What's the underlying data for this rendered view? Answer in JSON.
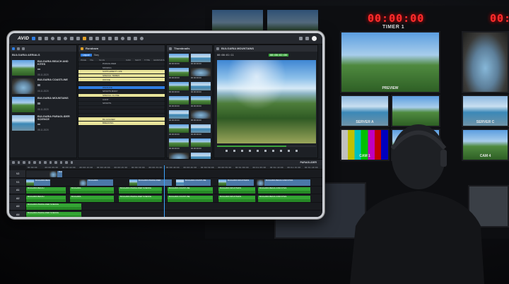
{
  "background": {
    "timers": [
      {
        "value": "00:00:00",
        "label": "TIMER 1"
      },
      {
        "value": "00:0",
        "label": ""
      }
    ],
    "monitors": [
      {
        "label": "PREVIEW"
      },
      {
        "label": "SERVER A"
      },
      {
        "label": "SERVER C"
      },
      {
        "label": "CAM 1"
      },
      {
        "label": "CAM 4"
      }
    ]
  },
  "app": {
    "logo": "AVID",
    "colors": {
      "accent": "#2f7de1",
      "audio_clip": "#34a534",
      "video_clip": "#4b78a8",
      "highlight_row": "#e8e39a",
      "timecode_green": "#3ba23c"
    }
  },
  "media_panel": {
    "title": "BULGARIA AERIALS",
    "items": [
      {
        "name": "BULGARIA BEACH AND KITES",
        "date": "05.11.2020"
      },
      {
        "name": "BULGARIA COASTLINE",
        "date": "05.11.2020"
      },
      {
        "name": "BULGARIA MOUNTAINS",
        "date": "05.11.2020"
      },
      {
        "name": "BULGARIA PARAGLIDER SCIENCE",
        "date": "05.11.2020"
      }
    ]
  },
  "bin_panel": {
    "title": "Rundown",
    "tabs": [
      "Layout",
      "Story"
    ],
    "columns": [
      "PAGE",
      "TAL",
      "SLUG",
      "CAM",
      "SHOT",
      "TYPE",
      "GRAPHICS"
    ],
    "rows": [
      {
        "slug": "PARAGLIDER",
        "style": "d"
      },
      {
        "slug": "MISSING",
        "style": "d"
      },
      {
        "slug": "SUPPLEMENT LIVE",
        "style": "y"
      },
      {
        "slug": "SPECIAL TRIBES",
        "style": "y"
      },
      {
        "slug": "OFFICE",
        "style": "y"
      },
      {
        "slug": "",
        "style": "d"
      },
      {
        "slug": "WILDLIFE",
        "style": "b"
      },
      {
        "slug": "SPORTS BODY",
        "style": "d"
      },
      {
        "slug": "SPECIAL CLOSE",
        "style": "y"
      },
      {
        "slug": "CONT",
        "style": "d"
      },
      {
        "slug": "SPORTS",
        "style": "d"
      },
      {
        "slug": "",
        "style": "d"
      },
      {
        "slug": "",
        "style": "d"
      },
      {
        "slug": "",
        "style": "d"
      },
      {
        "slug": "BG HOLDER",
        "style": "y"
      },
      {
        "slug": "BREAKING",
        "style": "y"
      }
    ]
  },
  "thumb_panel": {
    "title": "Thumbnails",
    "items": [
      "00:00:00:00",
      "00:00:00:00",
      "00:00:00:00",
      "00:00:00:00",
      "00:00:00:00",
      "00:00:00:00",
      "00:00:00:00",
      "00:00:00:00",
      "00:00:00:00",
      "00:00:00:00",
      "00:00:00:00",
      "00:00:00:00",
      "00:00:00:00",
      "00:00:00:00",
      "00:00:00:00",
      "00:00:00:00"
    ]
  },
  "viewer": {
    "title": "BULGARIA MOUNTAINS",
    "timecode_left": "00:00:01:11",
    "timecode_right": "00:00:02:00"
  },
  "timeline": {
    "sequence_name": "PARAGLIDER",
    "ruler": [
      "00:00:00",
      "00:00:05:00",
      "00:00:10:00",
      "00:00:15:00",
      "00:00:20:00",
      "00:00:25:00",
      "00:00:30:00",
      "00:00:35:00",
      "00:00:40:00",
      "00:00:45:00",
      "00:00:50:00",
      "00:00:55:00",
      "00:01:00:00",
      "00:01:05:00",
      "00:01:10:00",
      "00:01:15:00",
      "00:01:20:00"
    ],
    "tracks": [
      {
        "name": "V2",
        "clips": [
          {
            "kind": "dk",
            "name": ""
          },
          {
            "kind": "v",
            "name": "BULGARIA"
          }
        ]
      },
      {
        "name": "V1",
        "clips": [
          {
            "kind": "v",
            "name": "BULGARIA BEACH"
          },
          {
            "kind": "v",
            "name": "BULGARIA"
          },
          {
            "kind": "v",
            "name": "BULGARIA PARAGLIDER"
          },
          {
            "kind": "v",
            "name": "BULGARIA COASTLINE"
          },
          {
            "kind": "v",
            "name": "BULGARIA MOUNTAINS"
          },
          {
            "kind": "v",
            "name": "BULGARIA BEACH AND KITES"
          }
        ]
      },
      {
        "name": "A1",
        "clips": [
          {
            "kind": "a",
            "name": "BULGARIA BEACH"
          },
          {
            "kind": "a",
            "name": "BULGARIA"
          },
          {
            "kind": "a",
            "name": "BULGARIA PARAGLIDER SCIENCE"
          },
          {
            "kind": "a",
            "name": "BULGARIA COASTLINE"
          },
          {
            "kind": "a",
            "name": "BULGARIA MOUNTAINS"
          },
          {
            "kind": "a",
            "name": "BULGARIA BEACH AND KITES"
          }
        ]
      },
      {
        "name": "A2",
        "clips": [
          {
            "kind": "a",
            "name": "BULGARIA BEACH"
          },
          {
            "kind": "a",
            "name": "BULGARIA"
          },
          {
            "kind": "a",
            "name": "BULGARIA PARAGLIDER SCIENCE"
          },
          {
            "kind": "a",
            "name": "BULGARIA COASTLINE"
          },
          {
            "kind": "a",
            "name": "BULGARIA MOUNTAINS"
          },
          {
            "kind": "a",
            "name": "BULGARIA BEACH AND KITES"
          }
        ]
      },
      {
        "name": "A3",
        "clips": [
          {
            "kind": "a",
            "name": "BULGARIA PARAGLIDER SCIENCE"
          }
        ]
      },
      {
        "name": "A4",
        "clips": [
          {
            "kind": "a",
            "name": "BULGARIA PARAGLIDER SCIENCE"
          }
        ]
      }
    ]
  }
}
